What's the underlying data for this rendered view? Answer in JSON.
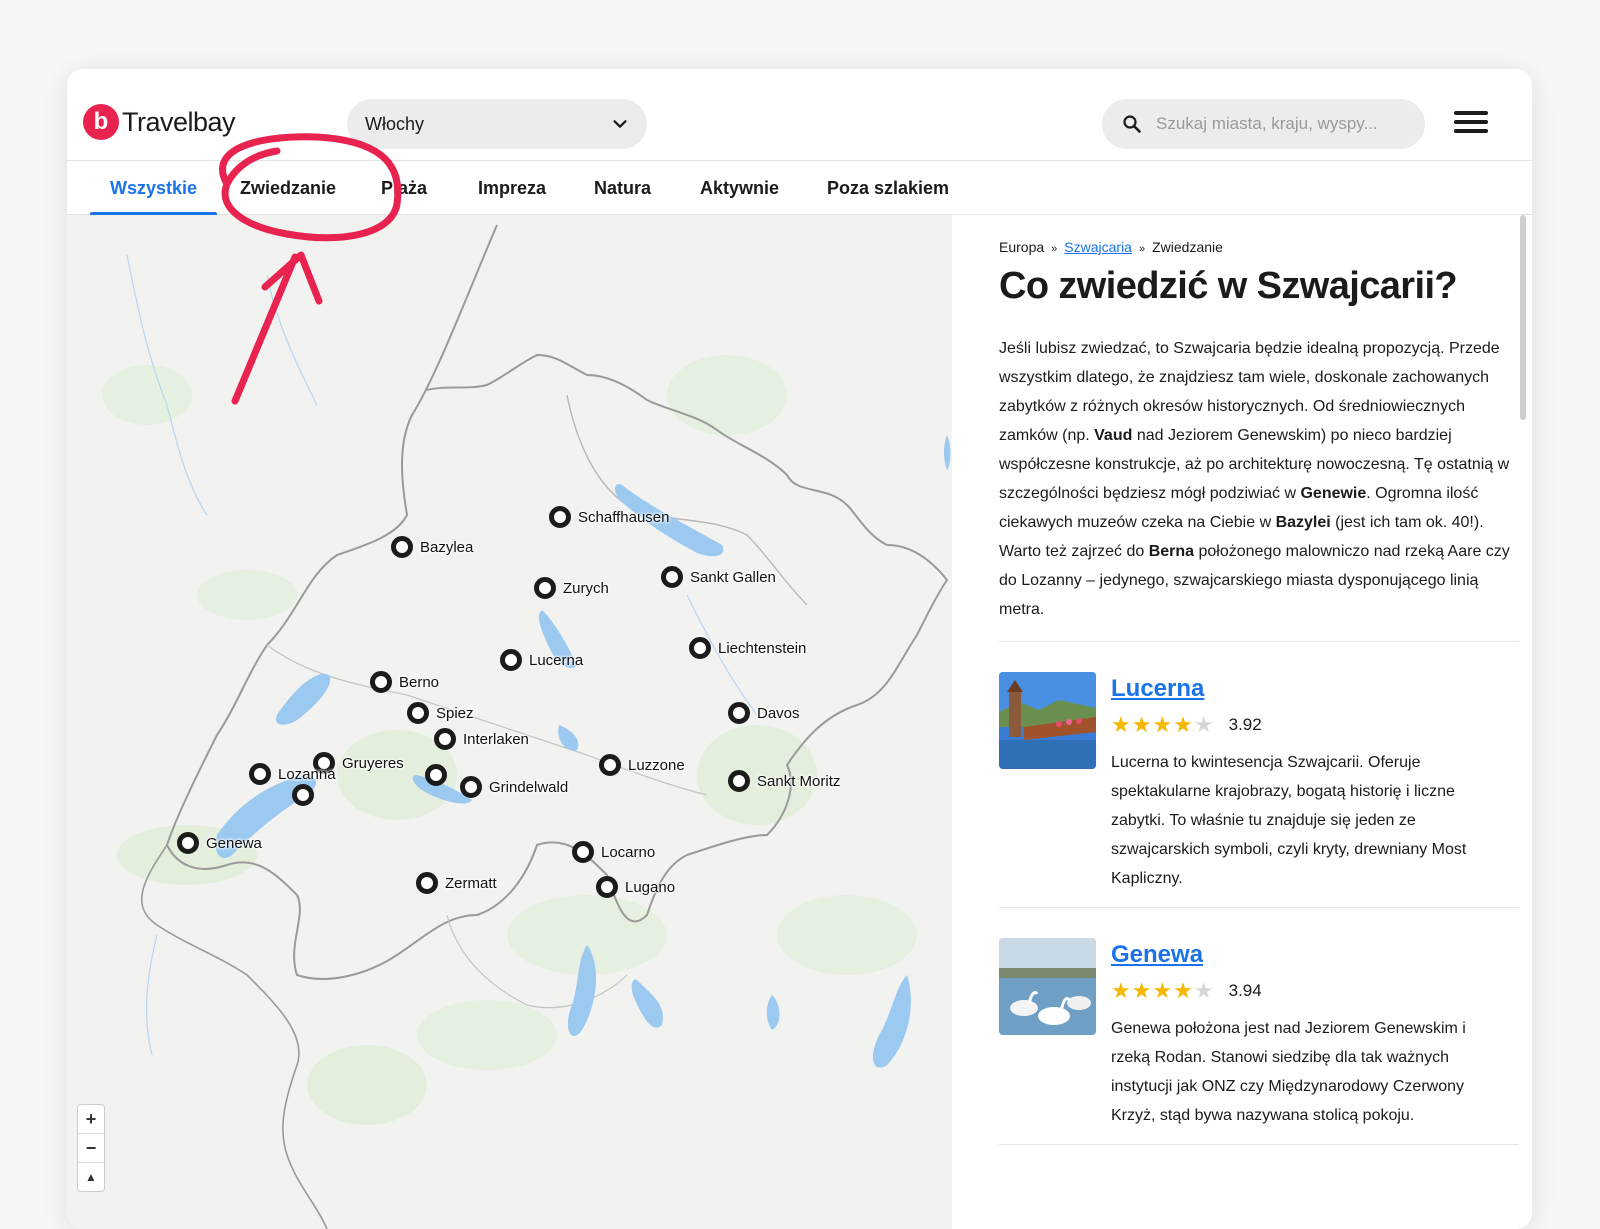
{
  "header": {
    "logo_mark": "b",
    "logo_text": "Travelbay",
    "country_select": "Włochy",
    "search_placeholder": "Szukaj miasta, kraju, wyspy..."
  },
  "tabs": [
    "Wszystkie",
    "Zwiedzanie",
    "Plaża",
    "Impreza",
    "Natura",
    "Aktywnie",
    "Poza szlakiem"
  ],
  "active_tab": "Wszystkie",
  "map": {
    "markers": [
      {
        "label": "Schaffhausen"
      },
      {
        "label": "Bazylea"
      },
      {
        "label": "Zurych"
      },
      {
        "label": "Sankt Gallen"
      },
      {
        "label": "Liechtenstein"
      },
      {
        "label": "Lucerna"
      },
      {
        "label": "Berno"
      },
      {
        "label": "Spiez"
      },
      {
        "label": "Davos"
      },
      {
        "label": "Interlaken"
      },
      {
        "label": "Gruyeres"
      },
      {
        "label": "Lozanna"
      },
      {
        "label": "Luzzone"
      },
      {
        "label": "Sankt Moritz"
      },
      {
        "label": ""
      },
      {
        "label": "Grindelwald"
      },
      {
        "label": ""
      },
      {
        "label": "Genewa"
      },
      {
        "label": "Locarno"
      },
      {
        "label": "Zermatt"
      },
      {
        "label": "Lugano"
      }
    ],
    "zoom_in": "+",
    "zoom_out": "−",
    "compass": "▲"
  },
  "panel": {
    "breadcrumb": {
      "root": "Europa",
      "link": "Szwajcaria",
      "current": "Zwiedzanie",
      "sep": "»"
    },
    "title": "Co zwiedzić w Szwajcarii?",
    "intro": [
      {
        "t": "Jeśli lubisz zwiedzać, to Szwajcaria będzie idealną propozycją. Przede wszystkim dlatego, że znajdziesz tam wiele, doskonale zachowanych zabytków z różnych okresów historycznych. Od średniowiecznych zamków (np. ",
        "b": false
      },
      {
        "t": "Vaud",
        "b": true
      },
      {
        "t": " nad Jeziorem Genewskim) po nieco bardziej współczesne konstrukcje, aż po architekturę nowoczesną. Tę ostatnią w szczególności będziesz mógł podziwiać w ",
        "b": false
      },
      {
        "t": "Genewie",
        "b": true
      },
      {
        "t": ". Ogromna ilość ciekawych muzeów czeka na Ciebie w ",
        "b": false
      },
      {
        "t": "Bazylei",
        "b": true
      },
      {
        "t": " (jest ich tam ok. 40!). Warto też zajrzeć do ",
        "b": false
      },
      {
        "t": "Berna",
        "b": true
      },
      {
        "t": " położonego malowniczo nad rzeką Aare czy do Lozanny – jedynego, szwajcarskiego miasta dysponującego linią metra.",
        "b": false
      }
    ],
    "places": [
      {
        "name": "Lucerna",
        "rating": 3.92,
        "stars": 4,
        "desc": "Lucerna to kwintesencja Szwajcarii. Oferuje spektakularne krajobrazy, bogatą historię i liczne zabytki. To właśnie tu znajduje się jeden ze szwajcarskich symboli, czyli kryty, drewniany Most Kapliczny."
      },
      {
        "name": "Genewa",
        "rating": 3.94,
        "stars": 4,
        "desc": "Genewa położona jest nad Jeziorem Genewskim i rzeką Rodan. Stanowi siedzibę dla tak ważnych instytucji jak ONZ czy Międzynarodowy Czerwony Krzyż, stąd bywa nazywana stolicą pokoju."
      }
    ]
  },
  "colors": {
    "accent": "#1a73e8",
    "brand": "#e8234f",
    "annotation": "#e8234f",
    "star": "#f5b800"
  }
}
